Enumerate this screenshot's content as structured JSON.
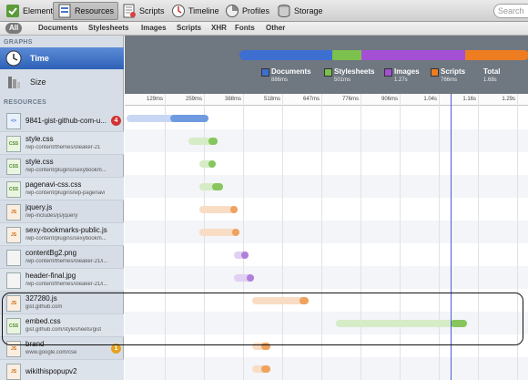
{
  "toolbar": {
    "tabs": [
      {
        "label": "Elements",
        "icon": "elements-icon",
        "active": false
      },
      {
        "label": "Resources",
        "icon": "resources-icon",
        "active": true
      },
      {
        "label": "Scripts",
        "icon": "scripts-icon",
        "active": false
      },
      {
        "label": "Timeline",
        "icon": "timeline-icon",
        "active": false
      },
      {
        "label": "Profiles",
        "icon": "profiles-icon",
        "active": false
      },
      {
        "label": "Storage",
        "icon": "storage-icon",
        "active": false
      }
    ],
    "search_placeholder": "Search"
  },
  "filters": [
    "All",
    "Documents",
    "Stylesheets",
    "Images",
    "Scripts",
    "XHR",
    "Fonts",
    "Other"
  ],
  "sidebar": {
    "graphs_title": "GRAPHS",
    "graphs": [
      {
        "label": "Time",
        "selected": true
      },
      {
        "label": "Size",
        "selected": false
      }
    ],
    "resources_title": "RESOURCES",
    "resources": [
      {
        "name": "9841-gist-github-com-u...",
        "sub": "",
        "type": "doc",
        "badge": "4",
        "badge_color": "#d23232"
      },
      {
        "name": "style.css",
        "sub": "/wp-content/themes/oleaker-21",
        "type": "css"
      },
      {
        "name": "style.css",
        "sub": "/wp-content/plugins/sexybookm...",
        "type": "css"
      },
      {
        "name": "pagenavi-css.css",
        "sub": "/wp-content/plugins/wp-pagenavi",
        "type": "css"
      },
      {
        "name": "jquery.js",
        "sub": "/wp-includes/js/jquery",
        "type": "js"
      },
      {
        "name": "sexy-bookmarks-public.js",
        "sub": "/wp-content/plugins/sexybookm...",
        "type": "js"
      },
      {
        "name": "contentBg2.png",
        "sub": "/wp-content/themes/oleaker-21/i...",
        "type": "img"
      },
      {
        "name": "header-final.jpg",
        "sub": "/wp-content/themes/oleaker-21/i...",
        "type": "img"
      },
      {
        "name": "327280.js",
        "sub": "gist.github.com",
        "type": "js"
      },
      {
        "name": "embed.css",
        "sub": "gist.github.com/stylesheets/gist",
        "type": "css"
      },
      {
        "name": "brand",
        "sub": "www.google.com/cse",
        "type": "js",
        "badge": "1",
        "badge_color": "#e6a21e"
      },
      {
        "name": "wikithispopupv2",
        "sub": "",
        "type": "js"
      }
    ]
  },
  "summary": {
    "legend": [
      {
        "label": "Documents",
        "value": "886ms",
        "color": "#3d6fd1"
      },
      {
        "label": "Stylesheets",
        "value": "501ms",
        "color": "#7cc04e"
      },
      {
        "label": "Images",
        "value": "1.27s",
        "color": "#a44fd4"
      },
      {
        "label": "Scripts",
        "value": "766ms",
        "color": "#ee7d21"
      },
      {
        "label": "Total",
        "value": "1.68s",
        "color": ""
      }
    ],
    "bar_fractions": [
      0.32,
      0.1,
      0.36,
      0.22
    ]
  },
  "timeline": {
    "ticks": [
      "129ms",
      "259ms",
      "388ms",
      "518ms",
      "647ms",
      "776ms",
      "906ms",
      "1.04s",
      "1.16s",
      "1.29s"
    ],
    "marker_fraction": 0.89,
    "rows": [
      {
        "start": 0.0,
        "end": 0.225,
        "fill_start": 0.12,
        "color": "blue"
      },
      {
        "start": 0.17,
        "end": 0.25,
        "fill_start": 0.225,
        "color": "green"
      },
      {
        "start": 0.2,
        "end": 0.245,
        "fill_start": 0.225,
        "color": "green"
      },
      {
        "start": 0.2,
        "end": 0.265,
        "fill_start": 0.235,
        "color": "green"
      },
      {
        "start": 0.2,
        "end": 0.305,
        "fill_start": 0.285,
        "color": "orange"
      },
      {
        "start": 0.2,
        "end": 0.31,
        "fill_start": 0.29,
        "color": "orange"
      },
      {
        "start": 0.295,
        "end": 0.335,
        "fill_start": 0.315,
        "color": "purple"
      },
      {
        "start": 0.295,
        "end": 0.35,
        "fill_start": 0.33,
        "color": "purple"
      },
      {
        "start": 0.345,
        "end": 0.5,
        "fill_start": 0.475,
        "color": "orange"
      },
      {
        "start": 0.575,
        "end": 0.935,
        "fill_start": 0.89,
        "color": "green"
      },
      {
        "start": 0.345,
        "end": 0.395,
        "fill_start": 0.37,
        "color": "orange"
      },
      {
        "start": 0.345,
        "end": 0.395,
        "fill_start": 0.37,
        "color": "orange"
      }
    ]
  },
  "colors": {
    "blue": [
      "#c8d8f4",
      "#6f9ae0"
    ],
    "green": [
      "#d6ecc6",
      "#86c65c"
    ],
    "orange": [
      "#f8dcc4",
      "#eea25e"
    ],
    "purple": [
      "#e2d0f2",
      "#b07fdc"
    ]
  }
}
